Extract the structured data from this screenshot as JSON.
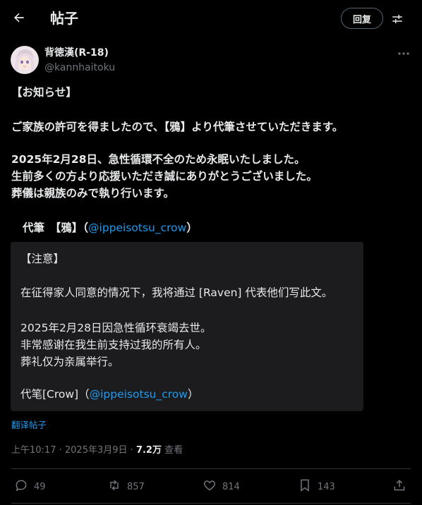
{
  "header": {
    "title": "帖子",
    "reply_label": "回复"
  },
  "author": {
    "name": "背徳漢(R-18)",
    "handle": "@kannhaitoku"
  },
  "post": {
    "line1": "【お知らせ】",
    "line2": "ご家族の許可を得ましたので、【鴉】より代筆させていただきます。",
    "line3": "2025年2月28日、急性循環不全のため永眠いたしました。",
    "line4": "生前多くの方より応援いただき誠にありがとうございました。",
    "line5": "葬儀は親族のみで執り行います。",
    "signature_prefix": "代筆　【鴉】（",
    "signature_mention": "@ippeisotsu_crow",
    "signature_suffix": "）"
  },
  "translation": {
    "line1": "【注意】",
    "line2": "在征得家人同意的情况下，我将通过 [Raven] 代表他们写此文。",
    "line3": "2025年2月28日因急性循环衰竭去世。",
    "line4": "非常感谢在我生前支持过我的所有人。",
    "line5": "葬礼仅为亲属举行。",
    "signature_prefix": "代笔[Crow]（",
    "signature_mention": "@ippeisotsu_crow",
    "signature_suffix": "）"
  },
  "translate_link": "翻译帖子",
  "meta": {
    "time": "上午10:17",
    "separator": "·",
    "date": "2025年3月9日",
    "views_count": "7.2万",
    "views_label": "查看"
  },
  "actions": {
    "replies": "49",
    "reposts": "857",
    "likes": "814",
    "bookmarks": "143"
  }
}
